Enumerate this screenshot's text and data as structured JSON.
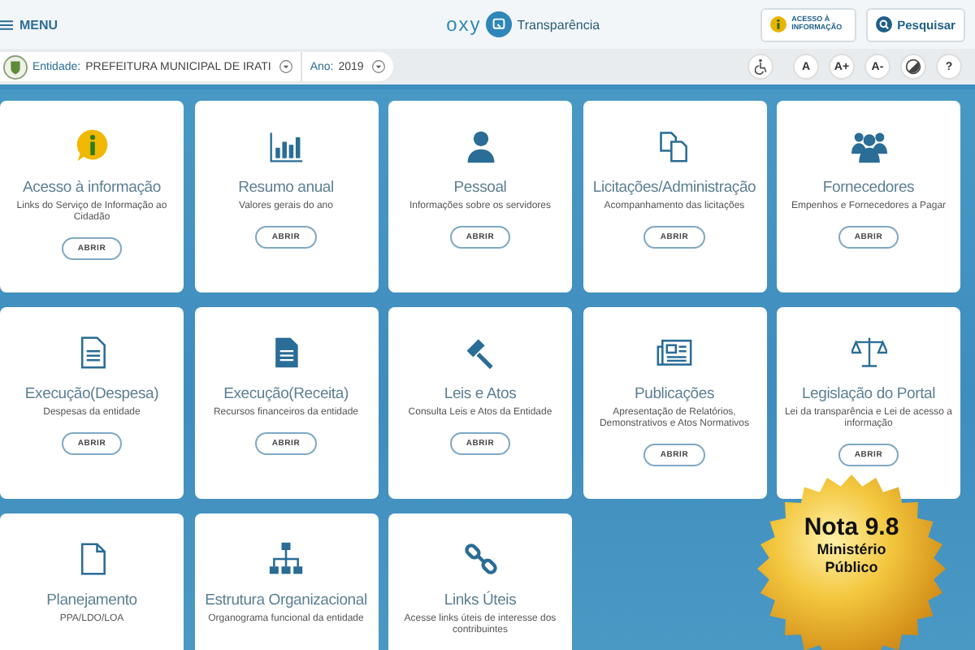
{
  "header": {
    "menu": "MENU",
    "logo": "oxy",
    "product": "Transparência",
    "info_button": "ACESSO À INFORMAÇÃO",
    "search_button": "Pesquisar"
  },
  "filters": {
    "entity_label": "Entidade:",
    "entity": "PREFEITURA MUNICIPAL DE IRATI",
    "year_label": "Ano:",
    "year": "2019"
  },
  "font_buttons": [
    "A",
    "A+",
    "A-"
  ],
  "help": "?",
  "cards": [
    {
      "title": "Acesso à informação",
      "description": "Links do Serviço de Informação ao Cidadão",
      "button": "ABRIR"
    },
    {
      "title": "Resumo anual",
      "description": "Valores gerais do ano",
      "button": "ABRIR"
    },
    {
      "title": "Pessoal",
      "description": "Informações sobre os servidores",
      "button": "ABRIR"
    },
    {
      "title": "Licitações/Administração",
      "description": "Acompanhamento das licitações",
      "button": "ABRIR"
    },
    {
      "title": "Fornecedores",
      "description": "Empenhos e Fornecedores a Pagar",
      "button": "ABRIR"
    },
    {
      "title": "Execução(Despesa)",
      "description": "Despesas da entidade",
      "button": "ABRIR"
    },
    {
      "title": "Execução(Receita)",
      "description": "Recursos financeiros da entidade",
      "button": "ABRIR"
    },
    {
      "title": "Leis e Atos",
      "description": "Consulta Leis e Atos da Entidade",
      "button": "ABRIR"
    },
    {
      "title": "Publicações",
      "description": "Apresentação de Relatórios, Demonstrativos e Atos Normativos",
      "button": "ABRIR"
    },
    {
      "title": "Legislação do Portal",
      "description": "Lei da transparência e Lei de acesso a informação",
      "button": "ABRIR"
    },
    {
      "title": "Planejamento",
      "description": "PPA/LDO/LOA"
    },
    {
      "title": "Estrutura Organizacional",
      "description": "Organograma funcional da entidade"
    },
    {
      "title": "Links Úteis",
      "description": "Acesse links úteis de interesse dos contribuintes"
    }
  ],
  "seal": {
    "lines": [
      "Nota 9.8",
      "Ministério",
      "Público"
    ]
  }
}
